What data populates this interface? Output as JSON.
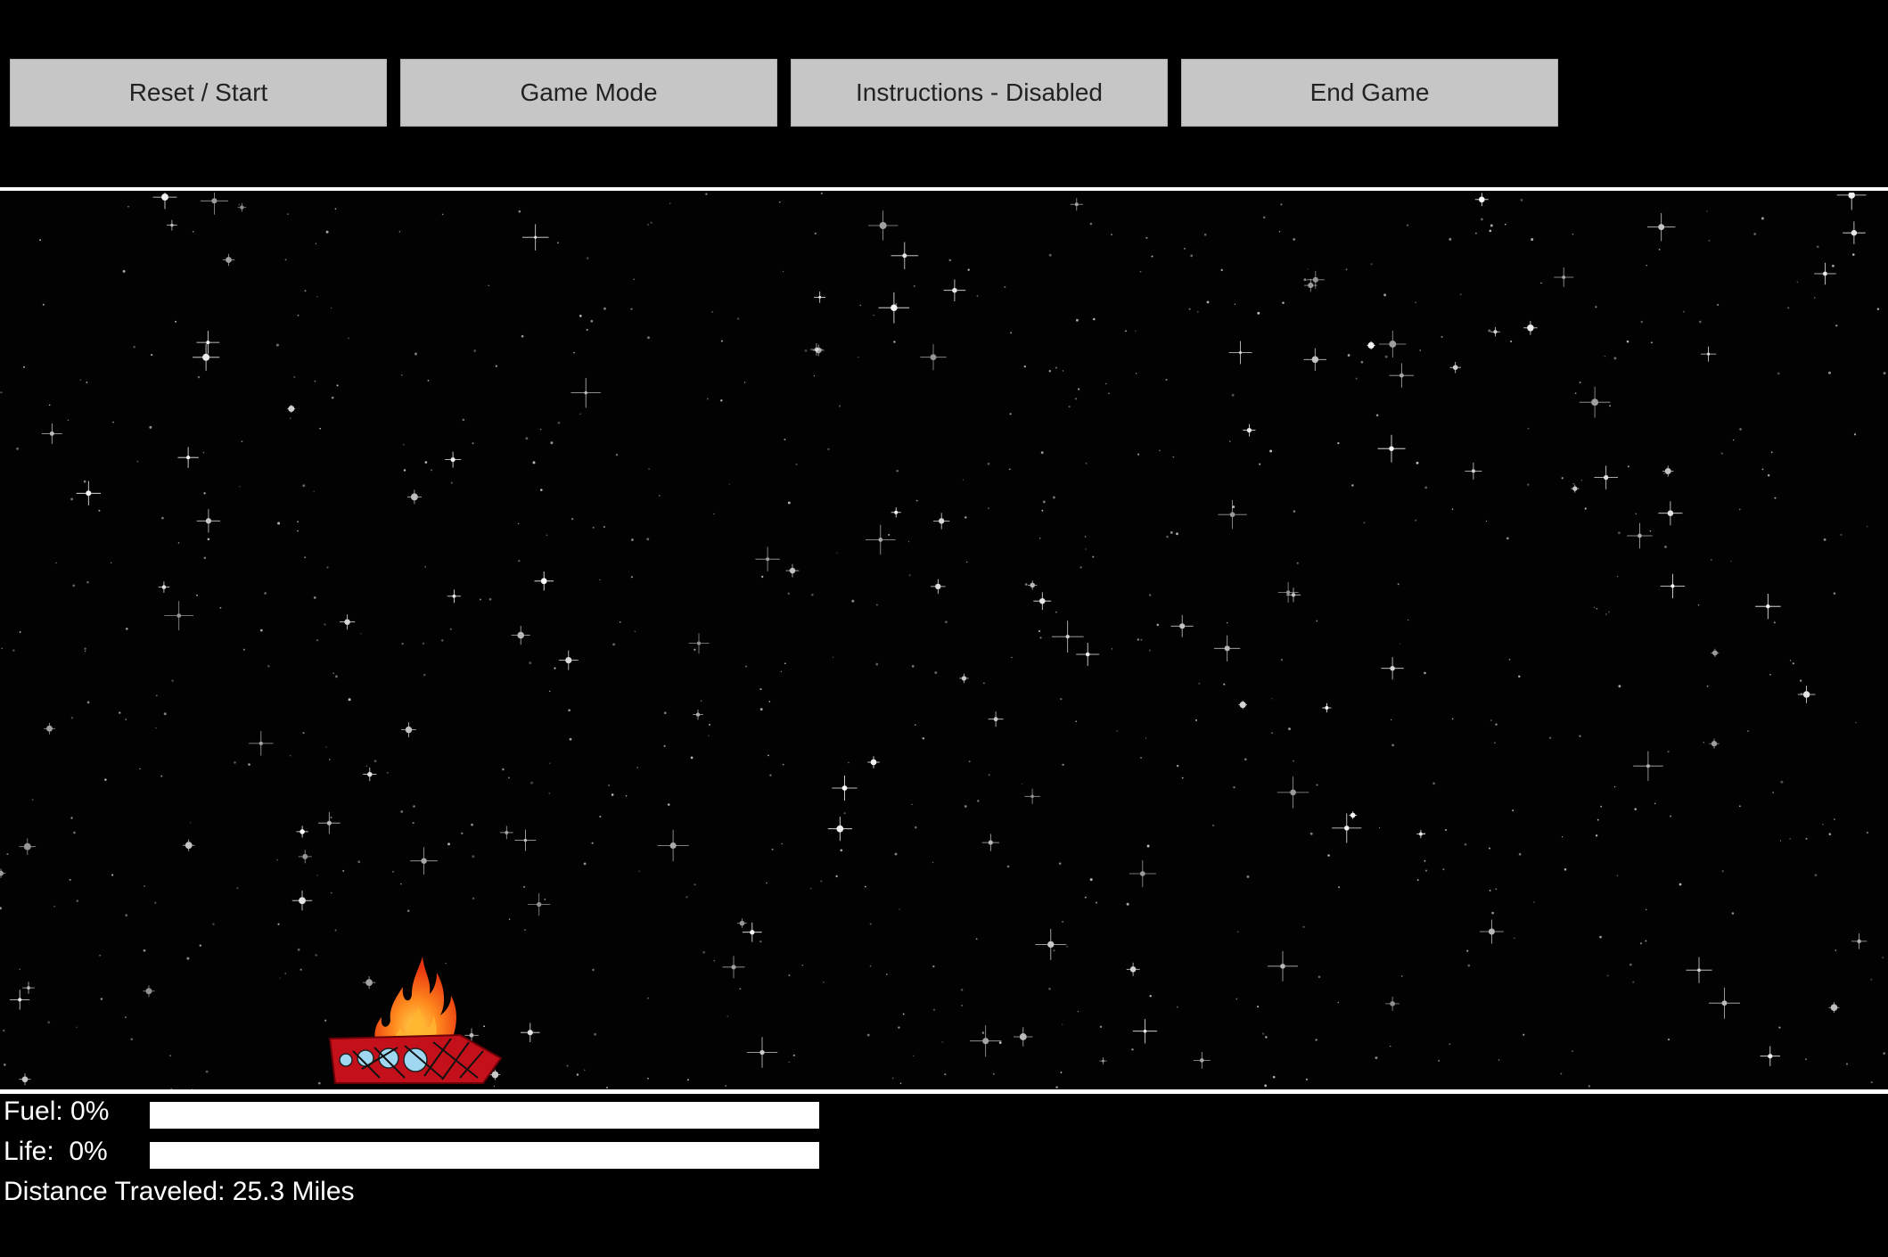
{
  "toolbar": {
    "reset_label": "Reset / Start",
    "mode_label": "Game Mode",
    "instructions_label": "Instructions - Disabled",
    "end_label": "End Game"
  },
  "hud": {
    "fuel_label": "Fuel: 0%",
    "fuel_percent": 0,
    "life_label": "Life:  0%",
    "life_percent": 0,
    "distance_label": "Distance Traveled: 25.3 Miles"
  },
  "colors": {
    "background": "#000000",
    "button_bg": "#c6c6c6",
    "bar_bg": "#ffffff",
    "ship_red": "#c4101b",
    "flame_orange": "#ff6a1a",
    "ship_window": "#9fd8f0"
  },
  "icons": {
    "ship": "burning-spaceship-icon"
  }
}
